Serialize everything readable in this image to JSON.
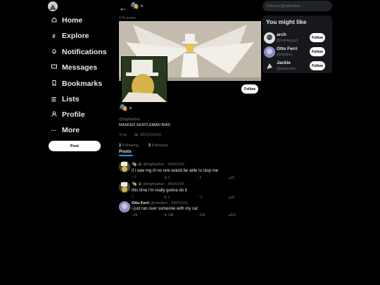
{
  "sidebar": {
    "items": [
      {
        "label": "Home",
        "icon": "home-icon"
      },
      {
        "label": "Explore",
        "icon": "hash-icon"
      },
      {
        "label": "Notifications",
        "icon": "bell-icon"
      },
      {
        "label": "Messages",
        "icon": "message-icon"
      },
      {
        "label": "Bookmarks",
        "icon": "bookmark-icon"
      },
      {
        "label": "Lists",
        "icon": "list-icon"
      },
      {
        "label": "Profile",
        "icon": "person-icon"
      },
      {
        "label": "More",
        "icon": "more-icon"
      }
    ],
    "post_label": "Post"
  },
  "header": {
    "back_icon": "back-arrow-icon",
    "name_suffix": "⊙",
    "post_count": "17k posts"
  },
  "profile": {
    "name_suffix": "⊙",
    "handle": "@mgfeather",
    "bio": "MASKED GENTLEMAN BIAS",
    "location": "no",
    "joined": "02/12/XXXX",
    "following_count": "2",
    "following_label": "Following",
    "followers_count": "2",
    "followers_label": "Followers",
    "follow_label": "Follow",
    "tab_posts": "Posts"
  },
  "posts": [
    {
      "name": "⊙",
      "handle": "@mgfeather · 4/9/XXXX",
      "text": "if i saw mg irl no one would be able to stop me",
      "replies": "1",
      "reposts": "1",
      "likes": "2",
      "views": "15"
    },
    {
      "name": "⊙",
      "handle": "@mgfeather · 4/8/XXXX",
      "text": "this time i'm really gonna do it",
      "replies": "",
      "reposts": "1",
      "likes": "2",
      "views": "16"
    },
    {
      "name": "Otto Ferri",
      "handle": "@ottoferri · 4/9/XXXX",
      "text": "i just ran over someone with my car",
      "replies": "2k",
      "reposts": "13k",
      "likes": "23k",
      "views": "51k"
    }
  ],
  "search": {
    "placeholder": "Search @mgfeather"
  },
  "suggest": {
    "title": "You might like",
    "users": [
      {
        "name": "arch",
        "handle": "@normalguy1",
        "follow": "Follow"
      },
      {
        "name": "Otto Ferri",
        "handle": "@ottoferri",
        "follow": "Follow"
      },
      {
        "name": "Jackie",
        "handle": "@username",
        "follow": "Follow"
      }
    ]
  },
  "colors": {
    "accent": "#1d9bf0",
    "background": "#000000",
    "panel": "#16181c",
    "muted": "#71767b"
  }
}
